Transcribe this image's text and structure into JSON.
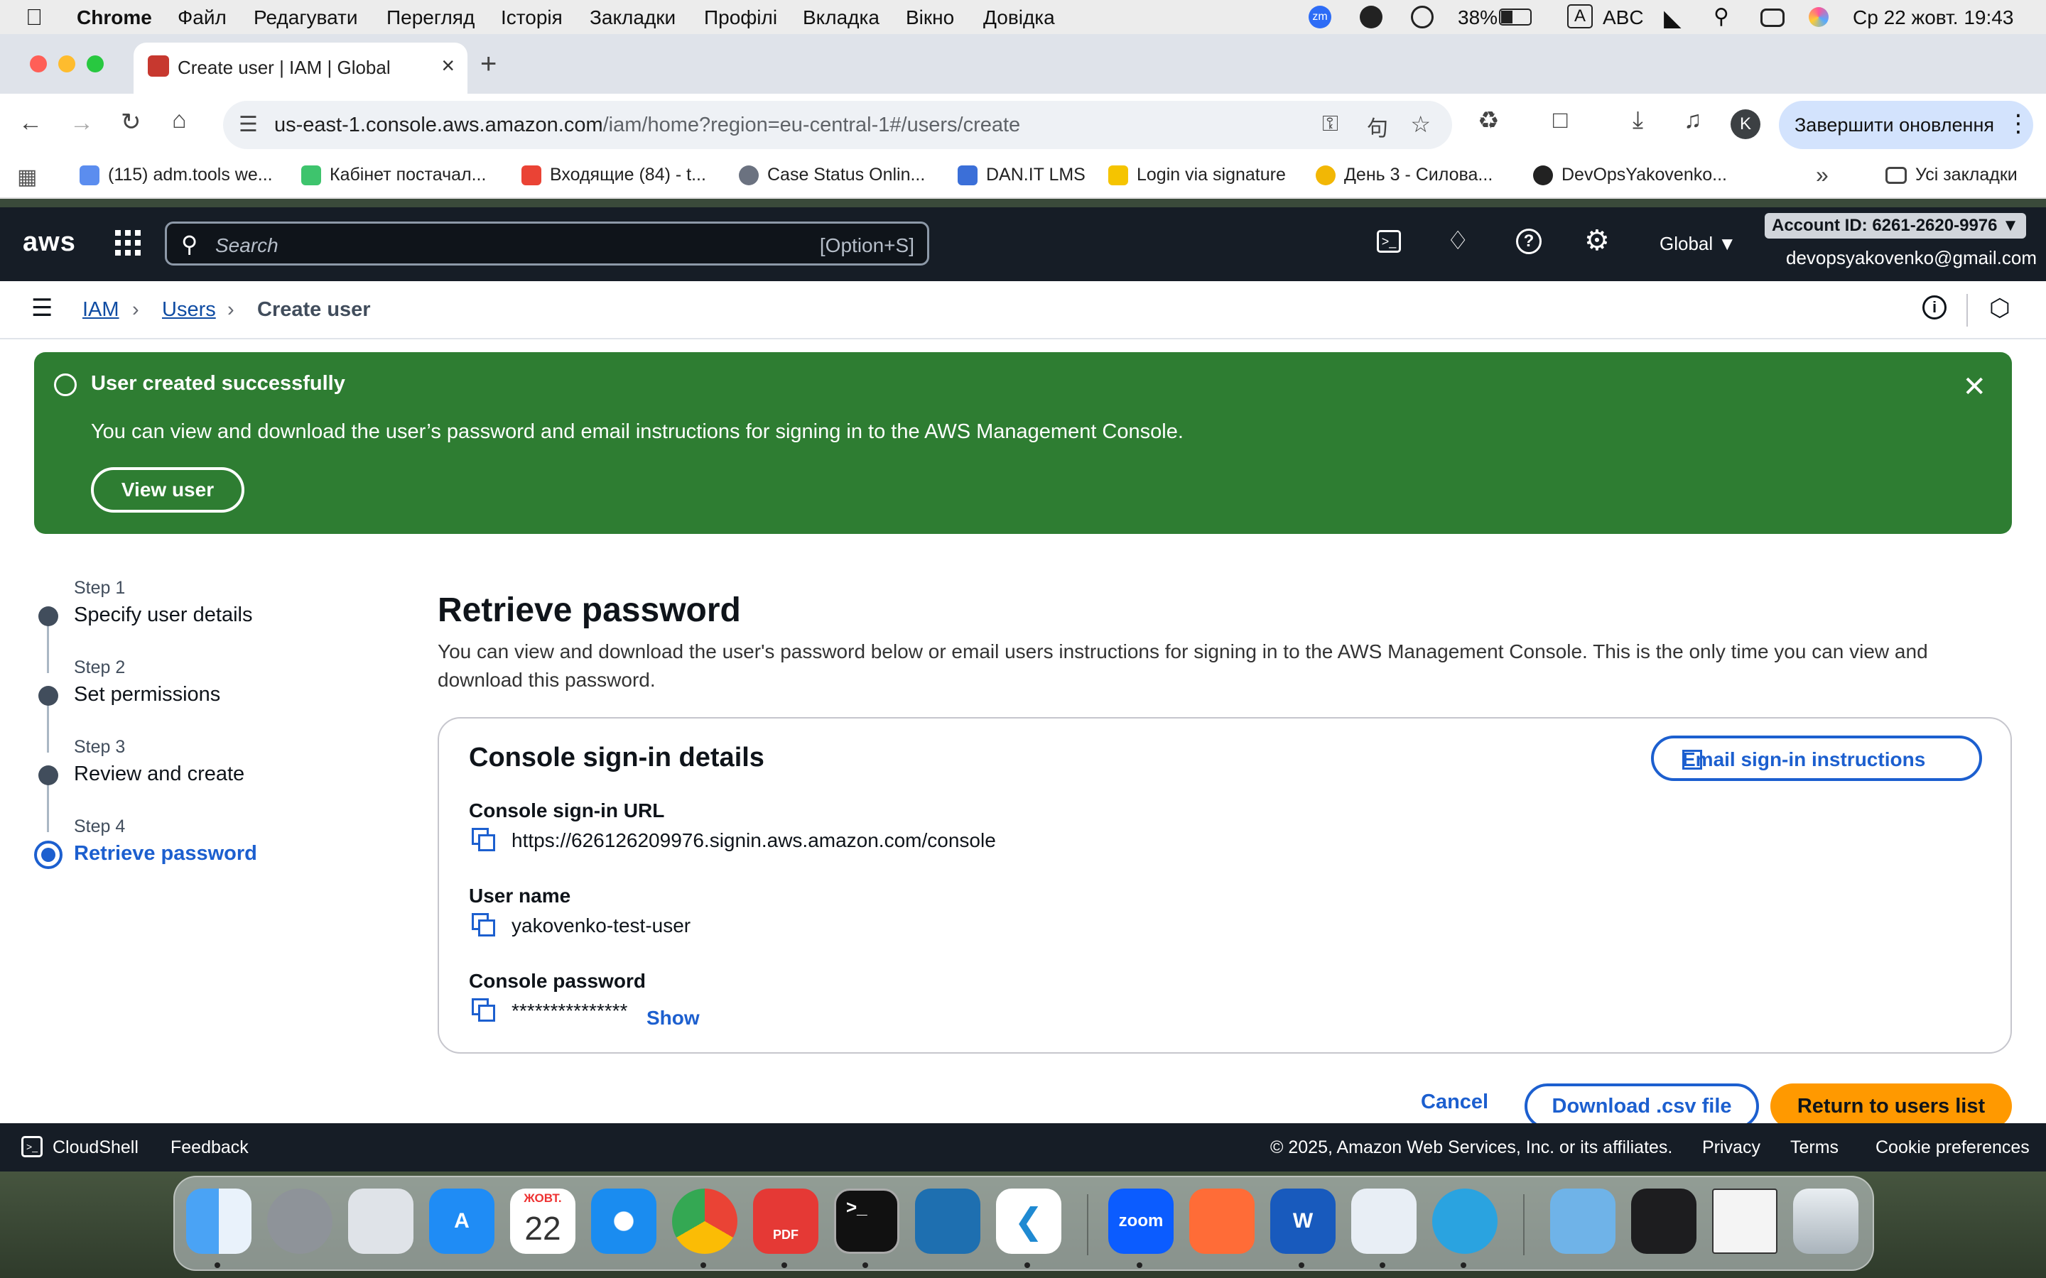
{
  "menubar": {
    "app": "Chrome",
    "items": [
      "Файл",
      "Редагувати",
      "Перегляд",
      "Історія",
      "Закладки",
      "Профілі",
      "Вкладка",
      "Вікно",
      "Довідка"
    ],
    "battery": "38%",
    "input_source": "ABC",
    "input_letter": "A",
    "zoom_badge": "zm",
    "datetime": "Ср 22 жовт.  19:43"
  },
  "browser": {
    "tab_title": "Create user | IAM | Global",
    "url_host": "us-east-1.console.aws.amazon.com",
    "url_path": "/iam/home?region=eu-central-1#/users/create",
    "profile_initial": "K",
    "update_label": "Завершити оновлення",
    "bookmarks": [
      {
        "label": "(115) adm.tools we...",
        "color": "#5b8def"
      },
      {
        "label": "Кабінет постачал...",
        "color": "#3ec46d"
      },
      {
        "label": "Входящие (84) - t...",
        "color": "#ea4335"
      },
      {
        "label": "Case Status Onlin...",
        "color": "#6b7280"
      },
      {
        "label": "DAN.IT LMS",
        "color": "#3b6fd8"
      },
      {
        "label": "Login via signature",
        "color": "#f5c400"
      },
      {
        "label": "День 3 - Силова...",
        "color": "#f2b705"
      },
      {
        "label": "DevOpsYakovenko...",
        "color": "#222222"
      }
    ],
    "all_bookmarks": "Усі закладки"
  },
  "aws": {
    "logo": "aws",
    "search_placeholder": "Search",
    "search_shortcut": "[Option+S]",
    "region": "Global",
    "account_id": "Account ID: 6261-2620-9976",
    "user_email": "devopsyakovenko@gmail.com"
  },
  "breadcrumb": {
    "iam": "IAM",
    "users": "Users",
    "current": "Create user"
  },
  "flash": {
    "title": "User created successfully",
    "message": "You can view and download the user’s password and email instructions for signing in to the AWS Management Console.",
    "button": "View user"
  },
  "steps": [
    {
      "number": "Step 1",
      "label": "Specify user details"
    },
    {
      "number": "Step 2",
      "label": "Set permissions"
    },
    {
      "number": "Step 3",
      "label": "Review and create"
    },
    {
      "number": "Step 4",
      "label": "Retrieve password"
    }
  ],
  "content": {
    "heading": "Retrieve password",
    "description": "You can view and download the user's password below or email users instructions for signing in to the AWS Management Console. This is the only time you can view and download this password.",
    "card_title": "Console sign-in details",
    "email_button": "Email sign-in instructions",
    "url_label": "Console sign-in URL",
    "url_value": "https://626126209976.signin.aws.amazon.com/console",
    "username_label": "User name",
    "username_value": "yakovenko-test-user",
    "password_label": "Console password",
    "password_value": "***************",
    "show_label": "Show"
  },
  "actions": {
    "cancel": "Cancel",
    "download": "Download .csv file",
    "return": "Return to users list"
  },
  "footer": {
    "cloudshell": "CloudShell",
    "feedback": "Feedback",
    "copyright": "© 2025, Amazon Web Services, Inc. or its affiliates.",
    "privacy": "Privacy",
    "terms": "Terms",
    "cookies": "Cookie preferences"
  },
  "dock": {
    "calendar_month": "ЖОВТ.",
    "calendar_day": "22",
    "zoom_label": "zoom",
    "pdf_label": "PDF",
    "word_label": "W"
  },
  "colors": {
    "aws_dark": "#161d26",
    "success": "#2e7d32",
    "link": "#1c5fcf",
    "primary": "#ff9900"
  }
}
